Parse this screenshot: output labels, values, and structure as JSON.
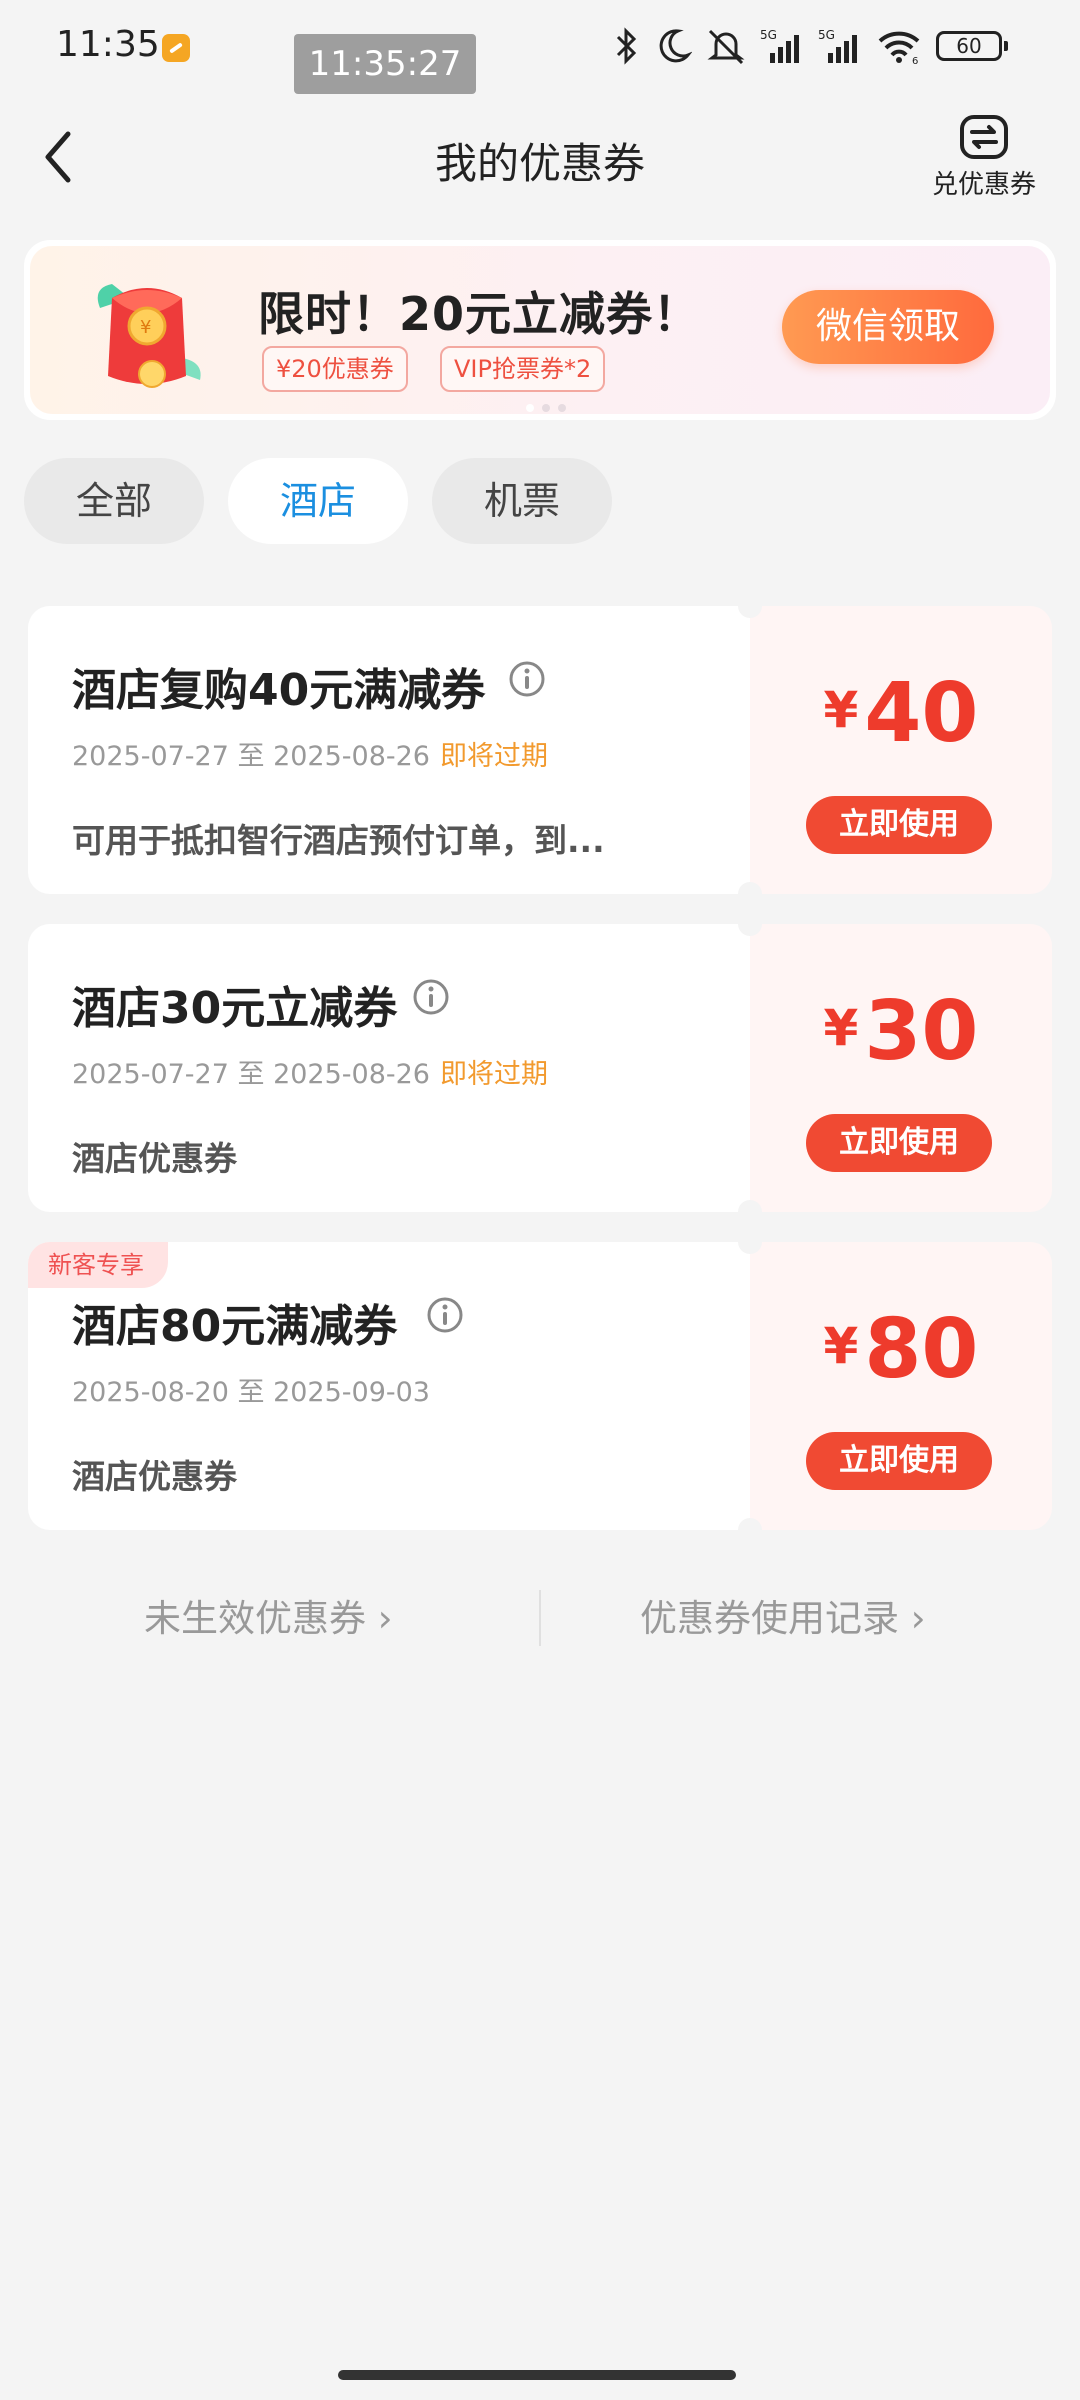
{
  "status_bar": {
    "time": "11:35",
    "clock_overlay": "11:35:27",
    "battery": "60",
    "network1": "5G",
    "network2": "5G",
    "wifi_sub": "6"
  },
  "header": {
    "title": "我的优惠券",
    "redeem_label": "兑优惠券"
  },
  "banner": {
    "title": "限时！20元立减券！",
    "tag1": "¥20优惠券",
    "tag2": "VIP抢票券*2",
    "cta": "微信领取"
  },
  "tabs": [
    {
      "label": "全部",
      "active": false
    },
    {
      "label": "酒店",
      "active": true
    },
    {
      "label": "机票",
      "active": false
    }
  ],
  "coupons": [
    {
      "title": "酒店复购40元满减券",
      "date": "2025-07-27 至 2025-08-26",
      "expiring": "即将过期",
      "desc": "可用于抵扣智行酒店预付订单，到...",
      "yen": "¥",
      "amount": "40",
      "use_label": "立即使用"
    },
    {
      "title": "酒店30元立减券",
      "date": "2025-07-27 至 2025-08-26",
      "expiring": "即将过期",
      "desc": "酒店优惠券",
      "yen": "¥",
      "amount": "30",
      "use_label": "立即使用"
    },
    {
      "badge": "新客专享",
      "title": "酒店80元满减券",
      "date": "2025-08-20 至 2025-09-03",
      "desc": "酒店优惠券",
      "yen": "¥",
      "amount": "80",
      "use_label": "立即使用"
    }
  ],
  "footer": {
    "inactive_link": "未生效优惠券 ›",
    "history_link": "优惠券使用记录 ›"
  },
  "colors": {
    "accent_blue": "#1b8fe0",
    "price_red": "#ee3b2c",
    "expiring_orange": "#f29a2e",
    "button_red": "#f04a33"
  }
}
